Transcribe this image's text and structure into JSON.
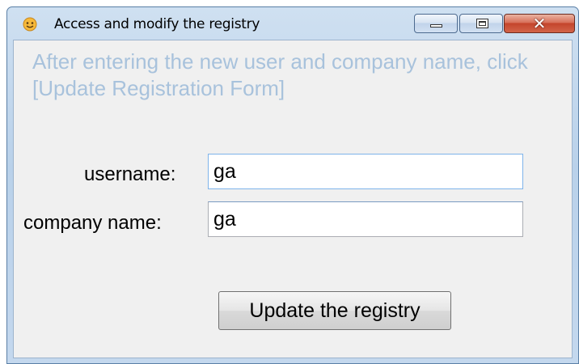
{
  "window": {
    "title": "Access and modify the registry",
    "icon": "app-smiley-icon",
    "controls": {
      "minimize_icon": "minimize-icon",
      "maximize_icon": "maximize-icon",
      "close_glyph": "✕"
    }
  },
  "form": {
    "instruction": "After entering the new user and company name, click [Update Registration Form]",
    "username_label": "username:",
    "username_value": "ga",
    "company_label": "company name:",
    "company_value": "ga",
    "submit_label": "Update the registry"
  },
  "colors": {
    "instruction_text": "#a8c2dc",
    "client_background": "#f0f0f0",
    "close_button": "#c4452c"
  }
}
